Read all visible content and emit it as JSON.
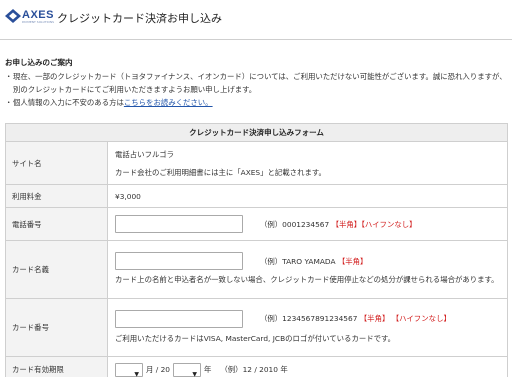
{
  "header": {
    "logo_text": "AXES",
    "logo_sub": "PAYMENT SOLUTIONS",
    "title": "クレジットカード決済お申し込み"
  },
  "notice": {
    "title": "お申し込みのご案内",
    "item1": "現在、一部のクレジットカード（トヨタファイナンス、イオンカード）については、ご利用いただけない可能性がございます。誠に恐れ入りますが、別のクレジットカードにてご利用いただきますようお願い申し上げます。",
    "item2_prefix": "個人情報の入力に不安のある方は",
    "item2_link": "こちらをお読みください。",
    "bullet": "・"
  },
  "form": {
    "caption": "クレジットカード決済申し込みフォーム",
    "site": {
      "label": "サイト名",
      "value": "電話占いフルゴラ",
      "note": "カード会社のご利用明細書には主に「AXES」と記載されます。"
    },
    "fee": {
      "label": "利用料金",
      "value": "¥3,000"
    },
    "phone": {
      "label": "電話番号",
      "example": "（例）0001234567",
      "tag1": "【半角】",
      "tag2": "【ハイフンなし】"
    },
    "card_name": {
      "label": "カード名義",
      "example": "（例）TARO YAMADA",
      "tag1": "【半角】",
      "note": "カード上の名前と申込者名が一致しない場合、クレジットカード使用停止などの処分が課せられる場合があります。"
    },
    "card_number": {
      "label": "カード番号",
      "example": "（例）1234567891234567",
      "tag1": "【半角】",
      "tag2": "【ハイフンなし】",
      "note": "ご利用いただけるカードはVISA, MasterCard, JCBのロゴが付いているカードです。"
    },
    "expiry": {
      "label": "カード有効期限",
      "month_unit": "月 / 20",
      "year_unit": "年",
      "example": "（例）12 / 2010 年",
      "month_value": "",
      "year_value": ""
    }
  }
}
